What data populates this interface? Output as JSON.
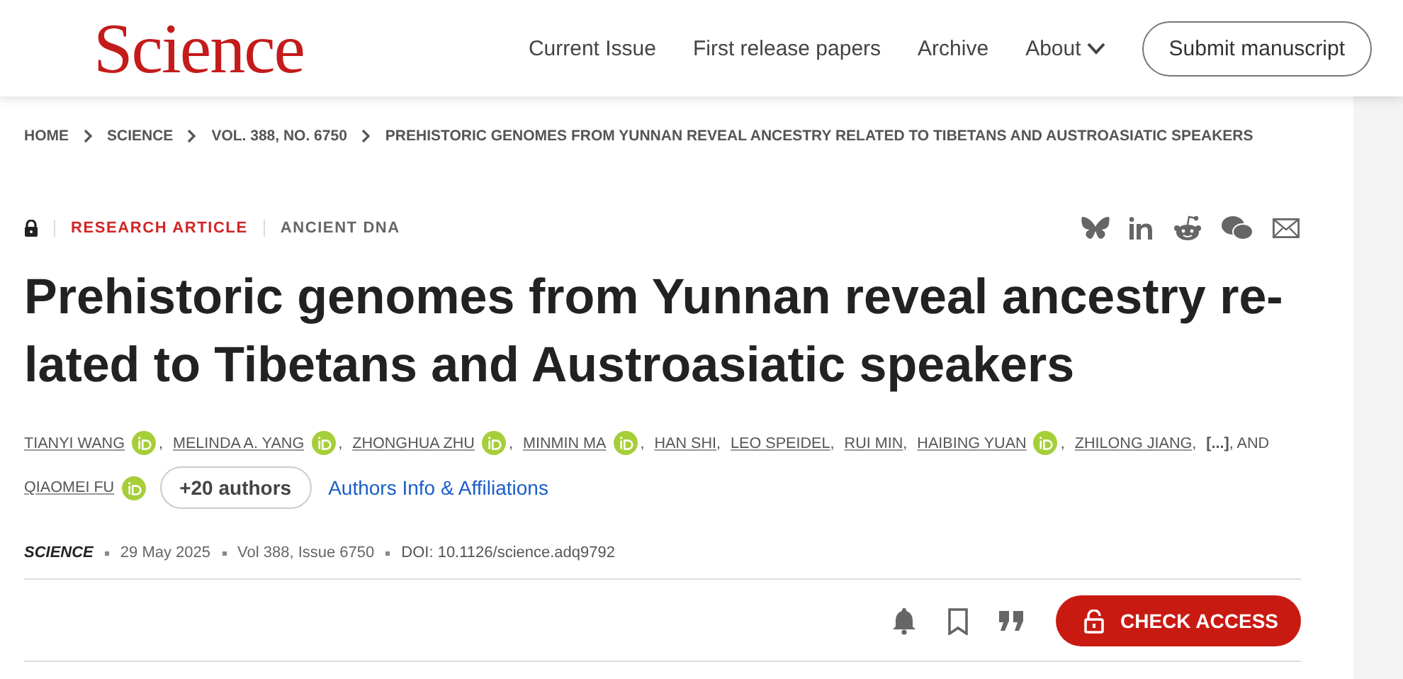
{
  "header": {
    "logo": "Science",
    "nav": [
      {
        "label": "Current Issue",
        "dropdown": false
      },
      {
        "label": "First release papers",
        "dropdown": false
      },
      {
        "label": "Archive",
        "dropdown": false
      },
      {
        "label": "About",
        "dropdown": true
      }
    ],
    "submit": "Submit manuscript"
  },
  "breadcrumbs": [
    "HOME",
    "SCIENCE",
    "VOL. 388, NO. 6750",
    "PREHISTORIC GENOMES FROM YUNNAN REVEAL ANCESTRY RELATED TO TIBETANS AND AUSTROASIATIC SPEAKERS"
  ],
  "article_type": "RESEARCH ARTICLE",
  "topic": "ANCIENT DNA",
  "title": "Prehistoric genomes from Yunnan reveal ancestry re-lated to Tibetans and Austroasiatic speakers",
  "authors": [
    {
      "kind": "author",
      "name": "TIANYI WANG",
      "orcid": true,
      "separator": ","
    },
    {
      "kind": "author",
      "name": "MELINDA A. YANG",
      "orcid": true,
      "separator": ","
    },
    {
      "kind": "author",
      "name": "ZHONGHUA ZHU",
      "orcid": true,
      "separator": ","
    },
    {
      "kind": "author",
      "name": "MINMIN MA",
      "orcid": true,
      "separator": ","
    },
    {
      "kind": "author",
      "name": "HAN SHI",
      "orcid": false,
      "separator": ","
    },
    {
      "kind": "author",
      "name": "LEO SPEIDEL",
      "orcid": false,
      "separator": ","
    },
    {
      "kind": "author",
      "name": "RUI MIN",
      "orcid": false,
      "separator": ","
    },
    {
      "kind": "author",
      "name": "HAIBING YUAN",
      "orcid": true,
      "separator": ","
    },
    {
      "kind": "author",
      "name": "ZHILONG JIANG",
      "orcid": false,
      "separator": ","
    },
    {
      "kind": "ellipsis",
      "name": "[...]",
      "separator": ", AND"
    },
    {
      "kind": "author",
      "name": "QIAOMEI FU",
      "orcid": true
    }
  ],
  "more_authors": "+20 authors",
  "affiliations": "Authors Info & Affiliations",
  "meta": {
    "journal": "SCIENCE",
    "date": "29 May 2025",
    "issue": "Vol 388, Issue 6750",
    "doi": "DOI: 10.1126/science.adq9792"
  },
  "check_access": "CHECK ACCESS"
}
